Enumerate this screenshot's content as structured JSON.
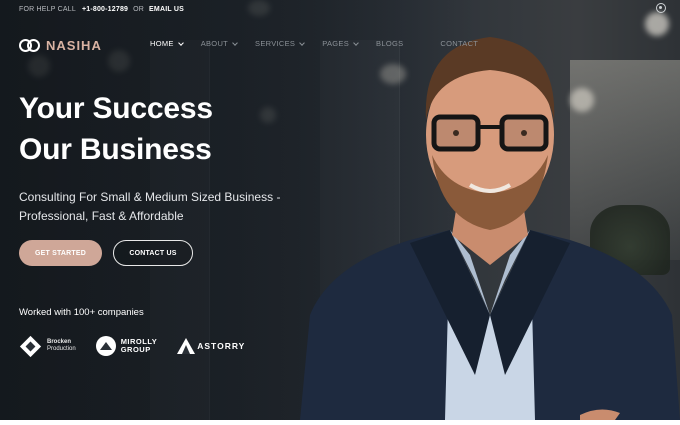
{
  "topbar": {
    "help_label": "FOR HELP CALL",
    "phone": "+1-800-12789",
    "or": "OR",
    "email": "EMAIL US",
    "settings_icon": "gear-icon"
  },
  "brand": {
    "name": "NASIHA",
    "logo_icon": "double-ring-logo-icon"
  },
  "nav": {
    "items": [
      {
        "label": "HOME",
        "active": true,
        "dropdown": true
      },
      {
        "label": "ABOUT",
        "active": false,
        "dropdown": true
      },
      {
        "label": "SERVICES",
        "active": false,
        "dropdown": true
      },
      {
        "label": "PAGES",
        "active": false,
        "dropdown": true
      },
      {
        "label": "BLOGS",
        "active": false,
        "dropdown": false
      },
      {
        "label": "CONTACT",
        "active": false,
        "dropdown": false
      }
    ]
  },
  "hero": {
    "headline_line1": "Your Success",
    "headline_line2": "Our Business",
    "sub_line1": "Consulting For Small & Medium Sized Business -",
    "sub_line2": "Professional, Fast & Affordable",
    "cta_primary": "GET STARTED",
    "cta_secondary": "CONTACT US",
    "worked_with": "Worked with 100+ companies"
  },
  "partners": [
    {
      "line1": "Brocken",
      "line2": "Production",
      "icon": "diamond-logo-icon"
    },
    {
      "line1": "MIROLLY",
      "line2": "GROUP",
      "icon": "mountain-circle-logo-icon"
    },
    {
      "line1": "ASTORRY",
      "line2": "",
      "icon": "triangle-a-logo-icon"
    }
  ],
  "colors": {
    "accent": "#cfa798",
    "logo_text": "#d9b3a3",
    "background_dark": "#1f252b"
  }
}
